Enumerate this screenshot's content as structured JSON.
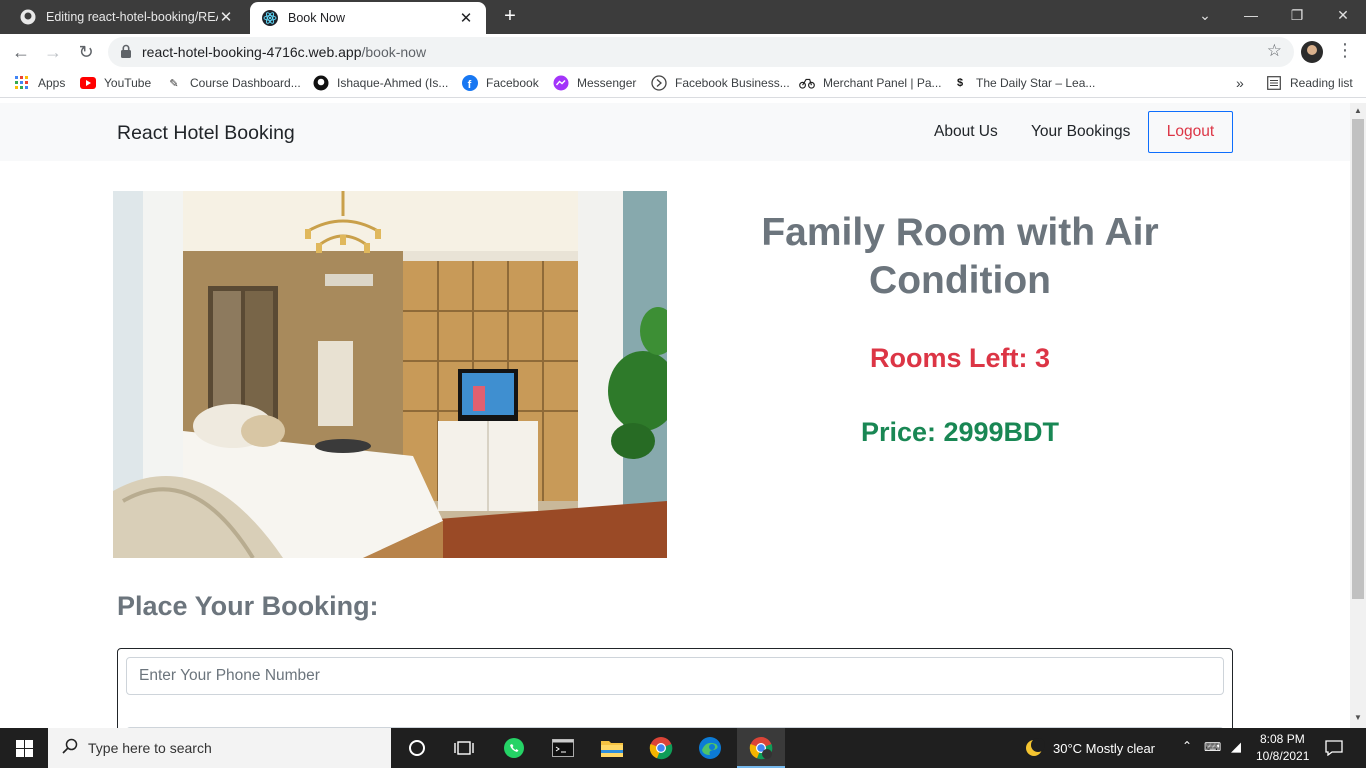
{
  "browser": {
    "tabs": [
      {
        "title": "Editing react-hotel-booking/REA",
        "active": false
      },
      {
        "title": "Book Now",
        "active": true
      }
    ],
    "url_host": "react-hotel-booking-4716c.web.app",
    "url_path": "/book-now",
    "bookmarks": [
      {
        "label": "Apps",
        "icon": "apps-grid-icon"
      },
      {
        "label": "YouTube",
        "icon": "youtube-icon"
      },
      {
        "label": "Course Dashboard...",
        "icon": "course-icon"
      },
      {
        "label": "Ishaque-Ahmed (Is...",
        "icon": "github-icon"
      },
      {
        "label": "Facebook",
        "icon": "facebook-icon"
      },
      {
        "label": "Messenger",
        "icon": "messenger-icon"
      },
      {
        "label": "Facebook Business...",
        "icon": "business-icon"
      },
      {
        "label": "Merchant Panel | Pa...",
        "icon": "bike-icon"
      },
      {
        "label": "The Daily Star – Lea...",
        "icon": "dailystar-icon"
      }
    ],
    "reading_list": "Reading list",
    "more_bookmarks": "»"
  },
  "navbar": {
    "brand": "React Hotel Booking",
    "links": [
      "About Us",
      "Your Bookings"
    ],
    "logout": "Logout"
  },
  "room": {
    "title": "Family Room with Air Condition",
    "rooms_left": "Rooms Left: 3",
    "price": "Price: 2999BDT"
  },
  "booking": {
    "heading": "Place Your Booking:",
    "phone_placeholder": "Enter Your Phone Number"
  },
  "taskbar": {
    "search_placeholder": "Type here to search",
    "weather": "30°C  Mostly clear",
    "time": "8:08 PM",
    "date": "10/8/2021"
  },
  "colors": {
    "danger": "#dc3545",
    "success": "#198754",
    "primary": "#0d6efd",
    "muted": "#6c757d"
  }
}
